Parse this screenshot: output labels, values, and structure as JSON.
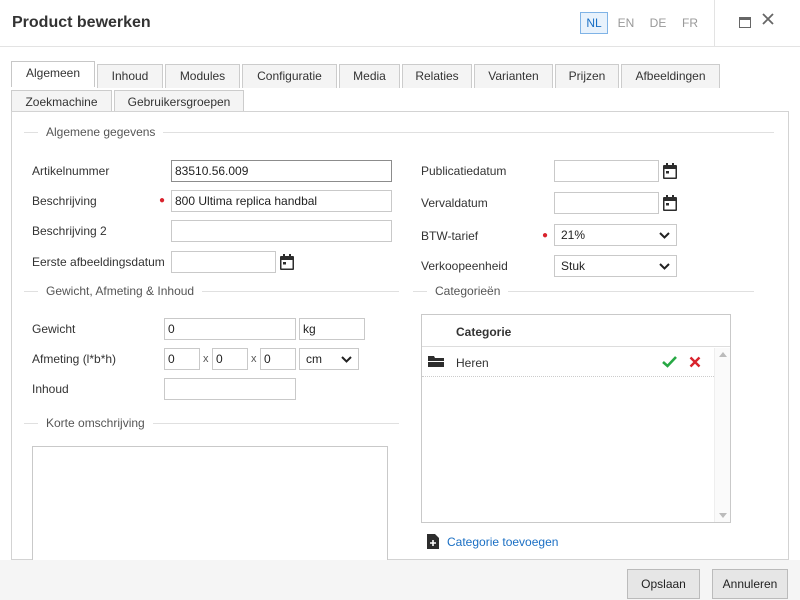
{
  "window": {
    "title": "Product bewerken"
  },
  "languages": [
    {
      "code": "NL",
      "active": true
    },
    {
      "code": "EN",
      "active": false
    },
    {
      "code": "DE",
      "active": false
    },
    {
      "code": "FR",
      "active": false
    }
  ],
  "tabs_row1": [
    "Algemeen",
    "Inhoud",
    "Modules",
    "Configuratie",
    "Media",
    "Relaties",
    "Varianten",
    "Prijzen",
    "Afbeeldingen"
  ],
  "tabs_row2": [
    "Zoekmachine",
    "Gebruikersgroepen"
  ],
  "active_tab": "Algemeen",
  "general": {
    "legend": "Algemene gegevens",
    "article_number": {
      "label": "Artikelnummer",
      "value": "83510.56.009"
    },
    "description": {
      "label": "Beschrijving",
      "value": "800 Ultima replica handbal"
    },
    "description2": {
      "label": "Beschrijving 2",
      "value": ""
    },
    "first_image_date": {
      "label": "Eerste afbeeldingsdatum",
      "value": ""
    },
    "publication_date": {
      "label": "Publicatiedatum",
      "value": ""
    },
    "expiry_date": {
      "label": "Vervaldatum",
      "value": ""
    },
    "vat": {
      "label": "BTW-tarief",
      "value": "21%"
    },
    "sales_unit": {
      "label": "Verkoopeenheid",
      "value": "Stuk"
    }
  },
  "weight_section": {
    "legend": "Gewicht, Afmeting & Inhoud",
    "weight": {
      "label": "Gewicht",
      "value": "0",
      "unit": "kg"
    },
    "dimensions": {
      "label": "Afmeting (l*b*h)",
      "l": "0",
      "b": "0",
      "h": "0",
      "separator": "x",
      "unit": "cm"
    },
    "content": {
      "label": "Inhoud",
      "value": ""
    }
  },
  "short_description": {
    "legend": "Korte omschrijving"
  },
  "categories": {
    "legend": "Categorieën",
    "column": "Categorie",
    "rows": [
      {
        "name": "Heren"
      }
    ],
    "add_link": "Categorie toevoegen"
  },
  "footer": {
    "save": "Opslaan",
    "cancel": "Annuleren"
  },
  "colors": {
    "accent": "#1a6fc4",
    "required": "#d9232d",
    "confirm": "#27a844",
    "delete": "#d9232d"
  }
}
